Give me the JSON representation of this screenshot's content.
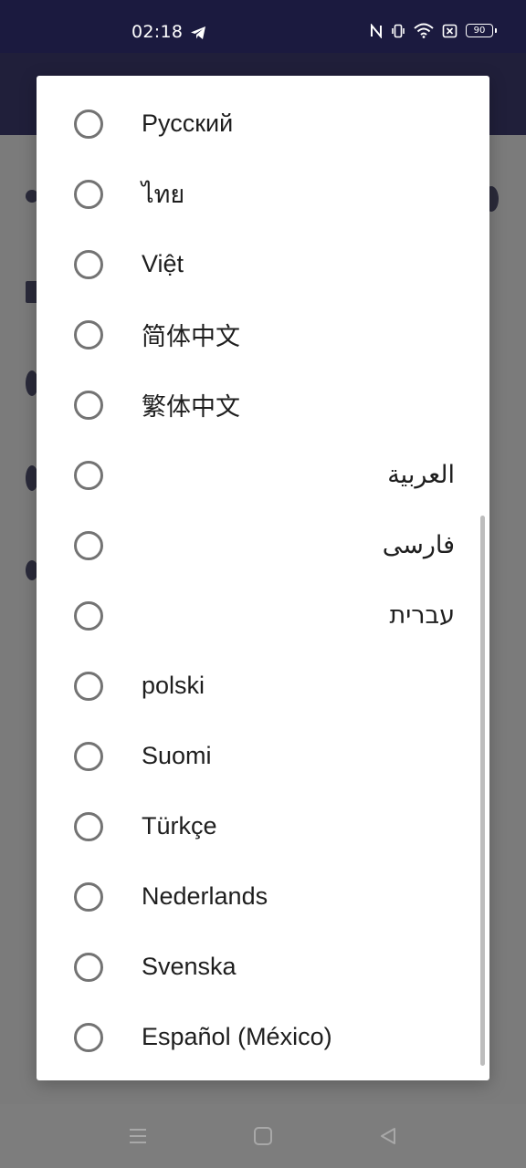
{
  "status_bar": {
    "time": "02:18",
    "battery": "90",
    "icons": [
      "telegram-icon",
      "nfc-icon",
      "vibrate-icon",
      "wifi-icon",
      "sim-error-icon",
      "battery-icon"
    ]
  },
  "dialog": {
    "options": [
      {
        "label": "Русский",
        "selected": false
      },
      {
        "label": "ไทย",
        "selected": false
      },
      {
        "label": "Việt",
        "selected": false
      },
      {
        "label": "简体中文",
        "selected": false
      },
      {
        "label": "繁体中文",
        "selected": false
      },
      {
        "label": "العربية",
        "selected": false
      },
      {
        "label": "فارسی",
        "selected": false
      },
      {
        "label": "עברית",
        "selected": false
      },
      {
        "label": "polski",
        "selected": false
      },
      {
        "label": "Suomi",
        "selected": false
      },
      {
        "label": "Türkçe",
        "selected": false
      },
      {
        "label": "Nederlands",
        "selected": false
      },
      {
        "label": "Svenska",
        "selected": false
      },
      {
        "label": "Español (México)",
        "selected": false
      }
    ]
  },
  "nav_bar": {
    "icons": [
      "menu-icon",
      "home-icon",
      "back-icon"
    ]
  },
  "colors": {
    "status_bar_bg": "#1b1a3f",
    "scrim": "#7b7b7b",
    "radio_border": "#737373",
    "text": "#1e1e1e"
  }
}
